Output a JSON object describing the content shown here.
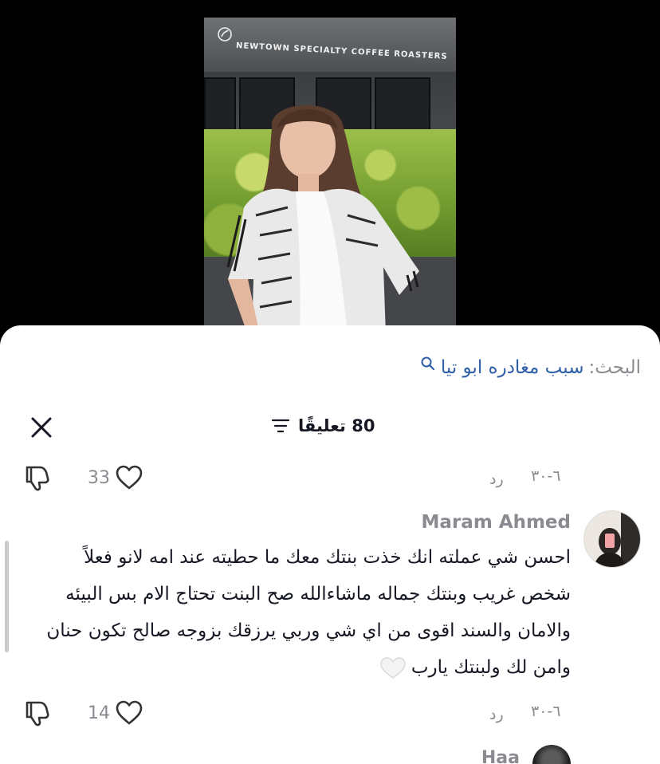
{
  "video": {
    "storefront_sign": "NEWTOWN SPECIALTY COFFEE ROASTERS"
  },
  "search": {
    "prefix": "البحث:",
    "term": "سبب مغادره ابو تيا"
  },
  "header": {
    "count_label": "80 تعليقًا"
  },
  "top_meta": {
    "date": "٦-٣٠",
    "reply_label": "رد",
    "like_count": "33"
  },
  "comments": [
    {
      "username": "Maram Ahmed",
      "text": "احسن شي عملته انك خذت بنتك معك ما حطيته عند امه لانو فعلاً شخص غريب وبنتك جماله ماشاءالله صح البنت تحتاج الام بس البيئه والامان والسند اقوى من اي شي وربي يرزقك بزوجه صالح تكون حنان وامن لك ولبنتك يارب",
      "date": "٦-٣٠",
      "reply_label": "رد",
      "like_count": "14"
    },
    {
      "username": "Haa"
    }
  ],
  "colors": {
    "accent_link": "#2f5fa6",
    "muted": "#8a8b91",
    "text": "#161823"
  }
}
